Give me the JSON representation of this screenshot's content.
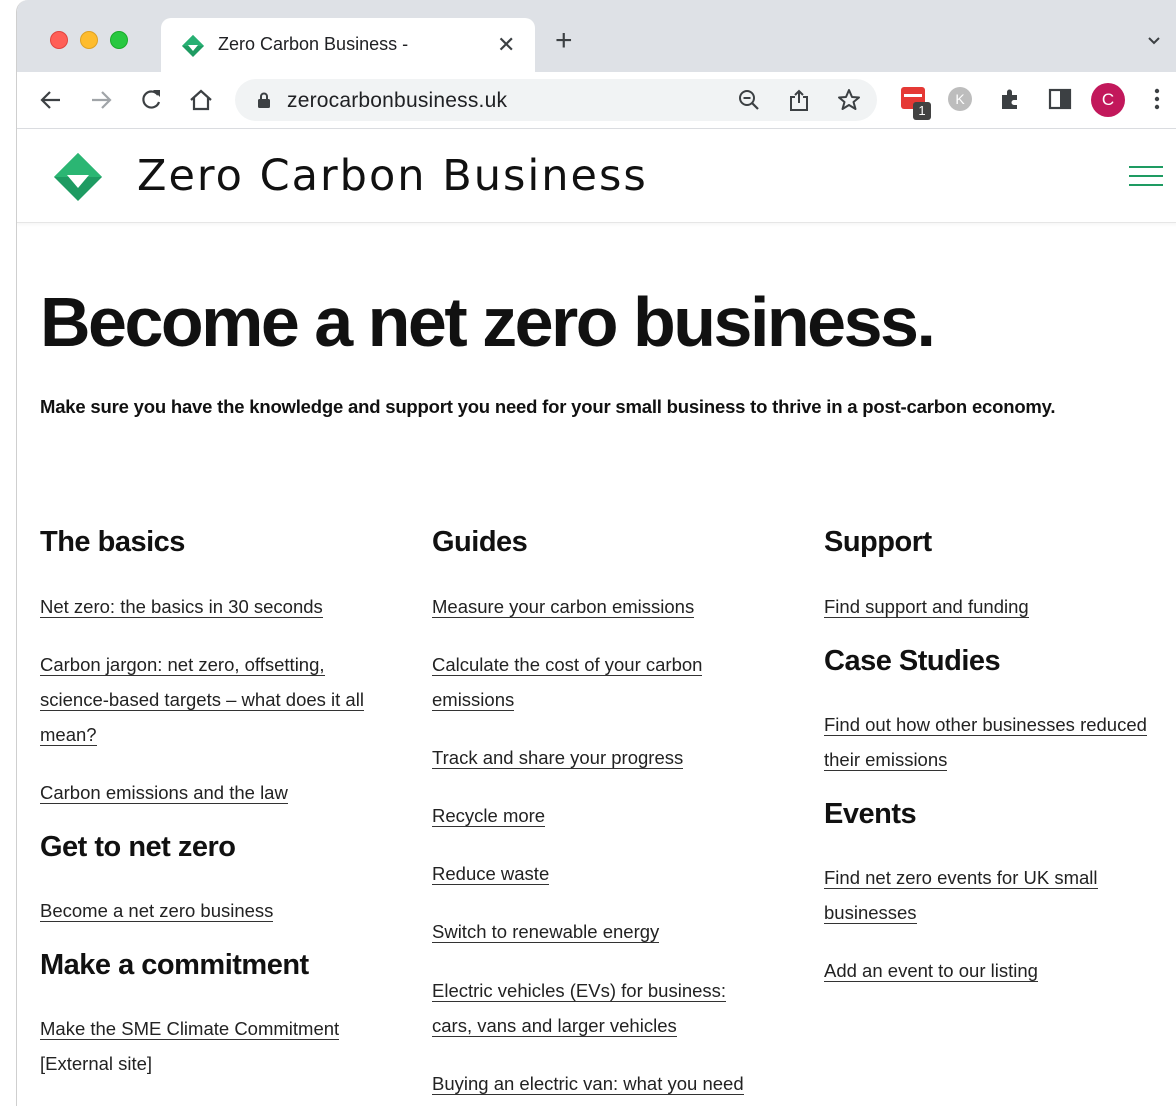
{
  "browser": {
    "tab_title": "Zero Carbon Business -",
    "url": "zerocarbonbusiness.uk",
    "extension_badge_count": "1",
    "profile_initial": "C"
  },
  "site": {
    "title": "Zero Carbon Business",
    "hero_title": "Become a net zero business.",
    "hero_subtitle": "Make sure you have the knowledge and support you need for your small business to thrive in a post-carbon economy."
  },
  "columns": {
    "basics": {
      "heading": "The basics",
      "links": [
        "Net zero: the basics in 30 seconds",
        "Carbon jargon: net zero, offsetting, science-based targets – what does it all mean?",
        "Carbon emissions and the law"
      ]
    },
    "get_to_net_zero": {
      "heading": "Get to net zero",
      "links": [
        "Become a net zero business"
      ]
    },
    "commitment": {
      "heading": "Make a commitment",
      "links": [
        "Make the SME Climate Commitment"
      ],
      "note": "[External site]"
    },
    "guides": {
      "heading": "Guides",
      "links": [
        "Measure your carbon emissions",
        "Calculate the cost of your carbon emissions",
        "Track and share your progress",
        "Recycle more",
        "Reduce waste",
        "Switch to renewable energy",
        "Electric vehicles (EVs) for business: cars, vans and larger vehicles",
        "Buying an electric van: what you need"
      ]
    },
    "support": {
      "heading": "Support",
      "links": [
        "Find support and funding"
      ]
    },
    "case_studies": {
      "heading": "Case Studies",
      "links": [
        "Find out how other businesses reduced their emissions"
      ]
    },
    "events": {
      "heading": "Events",
      "links": [
        "Find net zero events for UK small businesses",
        "Add an event to our listing"
      ]
    }
  },
  "colors": {
    "brand_green": "#1e9b62",
    "brand_dark_green": "#136b43"
  }
}
